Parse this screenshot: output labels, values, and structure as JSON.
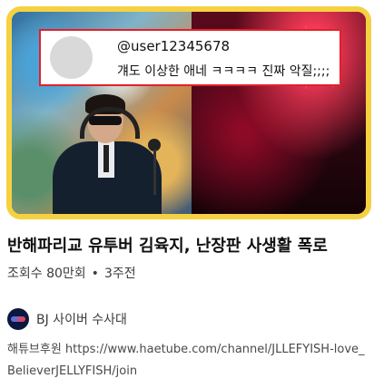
{
  "thumbnail": {
    "comment": {
      "username": "@user12345678",
      "text": "걔도 이상한 애네 ㅋㅋㅋㅋ 진짜 악질;;;;"
    },
    "border_color": "#f5d142",
    "comment_border_color": "#e2202a"
  },
  "video": {
    "title": "반해파리교 유투버 김육지, 난장판 사생활 폭로",
    "views": "조회수 80만회",
    "separator": "•",
    "age": "3주전"
  },
  "channel": {
    "name": "BJ 사이버 수사대"
  },
  "description": "해튜브후원 https://www.haetube.com/channel/JLLEFYISH-love_BelieverJELLYFISH/join"
}
